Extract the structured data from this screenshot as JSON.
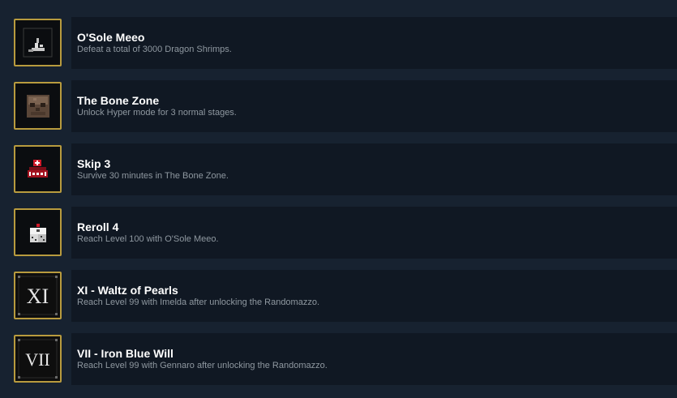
{
  "achievements": [
    {
      "title": "O'Sole Meeo",
      "description": "Defeat a total of 3000 Dragon Shrimps.",
      "icon": "shrimp-icon"
    },
    {
      "title": "The Bone Zone",
      "description": "Unlock Hyper mode for 3 normal stages.",
      "icon": "skull-icon"
    },
    {
      "title": "Skip 3",
      "description": "Survive 30 minutes in The Bone Zone.",
      "icon": "skip-icon"
    },
    {
      "title": "Reroll 4",
      "description": "Reach Level 100 with O'Sole Meeo.",
      "icon": "dice-icon"
    },
    {
      "title": "XI - Waltz of Pearls",
      "description": "Reach Level 99 with Imelda after unlocking the Randomazzo.",
      "icon": "arcana-xi-icon",
      "numeral": "XI"
    },
    {
      "title": "VII - Iron Blue Will",
      "description": "Reach Level 99 with Gennaro after unlocking the Randomazzo.",
      "icon": "arcana-vii-icon",
      "numeral": "VII"
    }
  ],
  "colors": {
    "background": "#172230",
    "card": "#101823",
    "frame_gold": "#b89b3e",
    "title": "#ffffff",
    "description": "#8f98a0"
  }
}
